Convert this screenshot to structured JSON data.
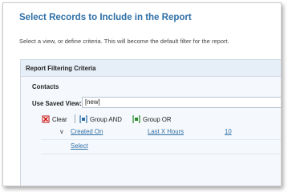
{
  "dialog": {
    "title": "Select Records to Include in the Report",
    "subtitle": "Select a view, or define criteria. This will become the default filter for the report."
  },
  "panel": {
    "header": "Report Filtering Criteria",
    "entity": "Contacts",
    "saved_view": {
      "label": "Use Saved View:",
      "value": "[new]"
    },
    "toolbar": {
      "clear_label": "Clear",
      "group_and_label": "Group AND",
      "group_or_label": "Group OR"
    },
    "criteria": [
      {
        "field": "Created On",
        "operator": "Last X Hours",
        "value": "10"
      }
    ],
    "select_link": "Select"
  },
  "colors": {
    "title": "#2f6fa7",
    "panel_header_bg": "#e6eef7",
    "panel_body_bg": "#f5f8fc",
    "link": "#2f6fa7"
  },
  "icons": [
    "clear-icon",
    "group-and-icon",
    "group-or-icon",
    "chevron-down-icon"
  ]
}
